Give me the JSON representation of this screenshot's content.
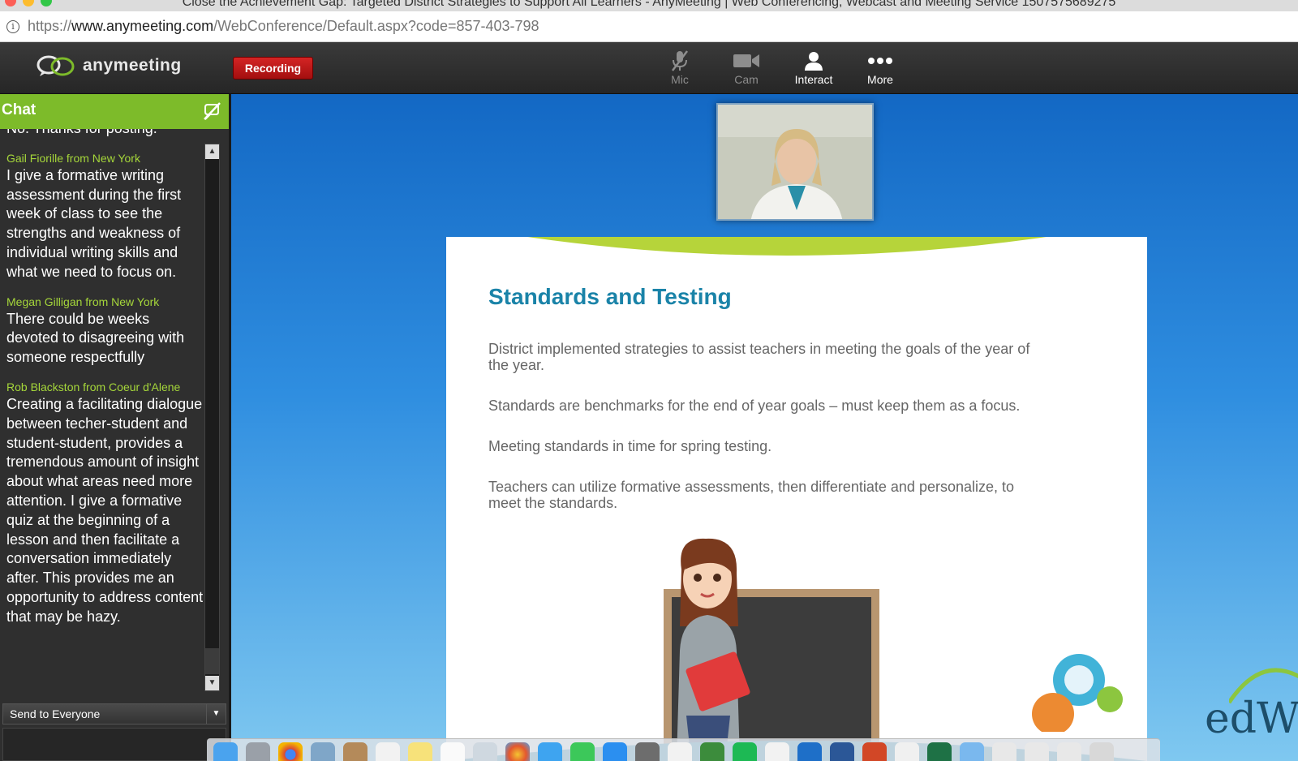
{
  "browser": {
    "window_title": "Close the Achievement Gap: Targeted District Strategies to Support All Learners - AnyMeeting | Web Conferencing, Webcast and Meeting Service 1507575689275",
    "url_prefix": "https://",
    "url_host": "www.anymeeting.com",
    "url_path": "/WebConference/Default.aspx?code=857-403-798"
  },
  "toolbar": {
    "logo_text": "anymeeting",
    "recording_label": "Recording",
    "tools": [
      {
        "label": "Mic",
        "icon": "mic-muted-icon",
        "state": "dim"
      },
      {
        "label": "Cam",
        "icon": "camera-icon",
        "state": "dim"
      },
      {
        "label": "Interact",
        "icon": "person-icon",
        "state": "on"
      },
      {
        "label": "More",
        "icon": "more-dots-icon",
        "state": "on"
      }
    ]
  },
  "chat": {
    "title": "Chat",
    "partial_message": "No. Thanks for posting.",
    "messages": [
      {
        "author": "Gail Fiorille from New York",
        "text": "I give a formative writing assessment during the first week of class to see the strengths and weakness of individual writing skills and what we need to focus on."
      },
      {
        "author": "Megan Gilligan from New York",
        "text": "There could be weeks devoted to disagreeing with someone respectfully"
      },
      {
        "author": "Rob Blackston from Coeur d'Alene",
        "text": "Creating a facilitating dialogue between techer-student and student-student, provides a tremendous amount of insight about what areas need more attention. I give a formative quiz at the beginning of a lesson and then facilitate a conversation immediately after. This provides me an opportunity to address content that may be hazy."
      }
    ],
    "send_to": "Send to Everyone"
  },
  "slide": {
    "title": "Standards and Testing",
    "bullets": [
      "District implemented strategies to assist teachers in meeting the goals of the year of the year.",
      "Standards are benchmarks for the end of year goals – must keep them as a focus.",
      "Meeting standards in time for spring testing.",
      "Teachers can utilize formative assessments, then differentiate and personalize, to meet the standards."
    ]
  },
  "branding": {
    "partial_logo": "edW"
  },
  "colors": {
    "accent_green": "#7dbb2a",
    "recording_red": "#c41a1a",
    "slide_title": "#1a83a8"
  }
}
